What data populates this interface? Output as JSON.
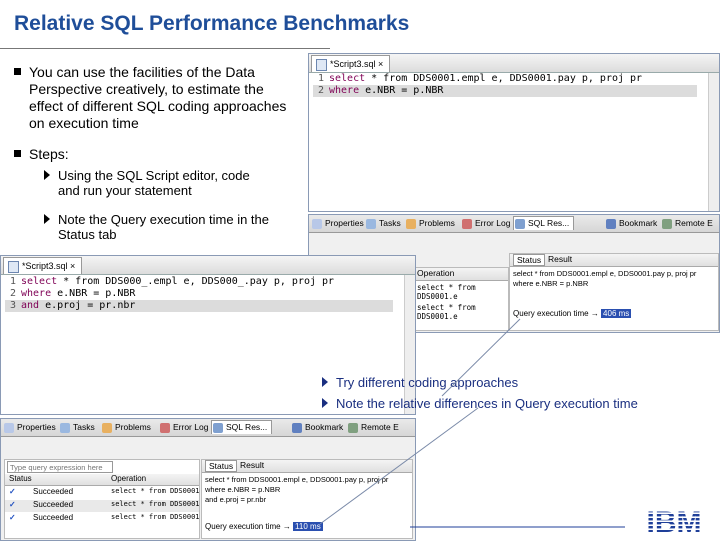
{
  "slide": {
    "title": "Relative SQL Performance Benchmarks",
    "bullets": [
      "You can use the facilities of the Data Perspective creatively, to estimate the effect of  different SQL coding approaches on execution time",
      "Steps:"
    ],
    "sub_bullets": [
      "Using the SQL Script editor, code and run your statement",
      "Note the Query execution time in the Status tab"
    ],
    "callouts": [
      "Try different coding approaches",
      "Note the relative differences in Query execution time"
    ],
    "logo": "IBM"
  },
  "editor1": {
    "tab": "*Script3.sql",
    "lines": [
      {
        "n": "1",
        "kw": "select",
        "rest": " * from DDS0001.empl e, DDS0001.pay p, proj pr"
      },
      {
        "n": "2",
        "kw": "where",
        "rest": " e.NBR = p.NBR"
      }
    ]
  },
  "editor2": {
    "tab": "*Script3.sql",
    "lines": [
      {
        "n": "1",
        "kw": "select",
        "rest": " * from DDS000_.empl e, DDS000_.pay p, proj pr"
      },
      {
        "n": "2",
        "kw": "where",
        "rest": " e.NBR = p.NBR"
      },
      {
        "n": "3",
        "kw": "and",
        "rest": " e.proj = pr.nbr"
      }
    ]
  },
  "views": {
    "tabs": [
      "Properties",
      "Tasks",
      "Problems",
      "Error Log",
      "SQL Res...",
      "Bookmark",
      "Remote E"
    ]
  },
  "results1": {
    "column": "Operation",
    "ops": [
      "select * from DDS0001.e",
      "select * from DDS0001.e"
    ],
    "status_tabs": [
      "Status",
      "Result"
    ],
    "status_text": [
      "select * from DDS0001.empl e, DDS0001.pay p, proj pr",
      "where e.NBR = p.NBR"
    ],
    "exec_label": "Query execution time →",
    "exec_value": "406 ms"
  },
  "results2": {
    "filter_placeholder": "Type query expression here",
    "columns": [
      "Status",
      "Operation"
    ],
    "rows": [
      {
        "status": "Succeeded",
        "op": "select * from DDS0001.e"
      },
      {
        "status": "Succeeded",
        "op": "select * from DDS0001.e"
      },
      {
        "status": "Succeeded",
        "op": "select * from DDS0001.e"
      }
    ],
    "status_tabs": [
      "Status",
      "Result"
    ],
    "status_text": [
      "select * from DDS0001.empl e, DDS0001.pay p, proj pr",
      "where e.NBR = p.NBR",
      "and e.proj = pr.nbr"
    ],
    "exec_label": "Query execution time →",
    "exec_value": "110 ms"
  },
  "colors": {
    "title": "#1f4e99",
    "ibm": "#1f3f99",
    "highlight": "#2a4fb0"
  }
}
